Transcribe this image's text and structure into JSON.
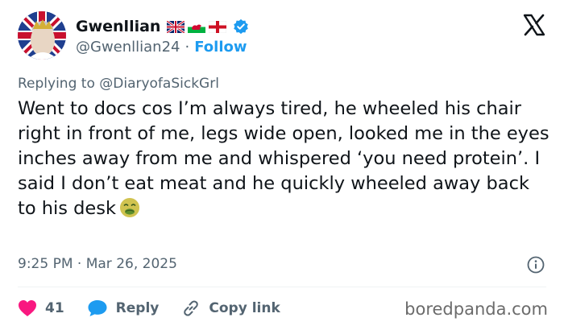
{
  "author": {
    "display_name": "Gwenllian",
    "handle": "@Gwenllian24",
    "separator": "·",
    "follow_label": "Follow"
  },
  "reply": {
    "prefix": "Replying to",
    "mention": "@DiaryofaSickGrl"
  },
  "tweet": {
    "text": "Went to docs cos I’m always tired, he wheeled his chair right in front of me, legs wide open, looked me in the eyes inches away from me and whispered ‘you need protein’. I said I don’t eat meat and he quickly wheeled away back to his desk",
    "timestamp": "9:25 PM · Mar 26, 2025"
  },
  "actions": {
    "like_count": "41",
    "reply_label": "Reply",
    "copy_label": "Copy link"
  },
  "watermark": "boredpanda.com",
  "icons": [
    "union-jack-flag-icon",
    "welsh-flag-icon",
    "england-flag-icon",
    "verified-badge-icon",
    "x-logo-icon",
    "nauseated-face-emoji-icon",
    "info-icon",
    "heart-icon",
    "reply-bubble-icon",
    "link-icon"
  ],
  "colors": {
    "accent": "#1d9bf0",
    "like": "#f91880",
    "muted": "#536471",
    "text": "#0f1419"
  }
}
